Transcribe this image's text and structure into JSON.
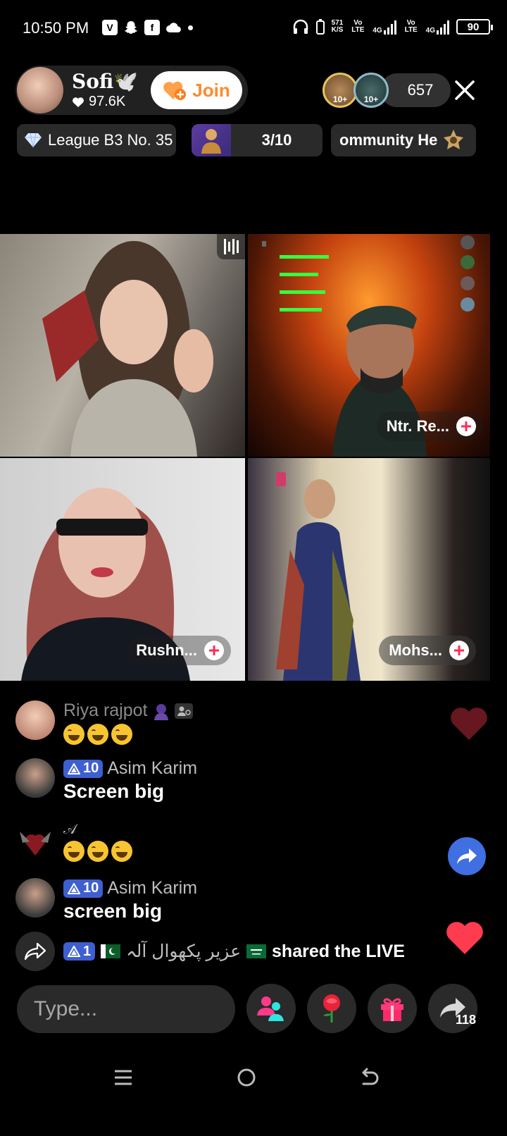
{
  "status_bar": {
    "time": "10:50 PM",
    "net_speed_value": "571",
    "net_speed_unit": "K/S",
    "sim1_type": "4G",
    "sim2_type": "4G",
    "volte1": "Vo LTE",
    "volte2": "Vo LTE",
    "battery": "90"
  },
  "host": {
    "name": "Sofi🕊️",
    "likes": "97.6K",
    "join_label": "Join"
  },
  "viewers": {
    "badge1": "10+",
    "badge2": "10+",
    "count": "657"
  },
  "badges": {
    "league": "League B3 No. 35",
    "rank_progress": "3/10",
    "community": "ommunity He"
  },
  "guests": [
    {
      "name": ""
    },
    {
      "name": "Ntr. Re..."
    },
    {
      "name": "Rushn..."
    },
    {
      "name": "Mohs..."
    }
  ],
  "chat": [
    {
      "user": "Riya rajpot",
      "level": "",
      "message": ""
    },
    {
      "user": "Asim Karim",
      "level": "10",
      "message": "Screen big"
    },
    {
      "user": "𝒜",
      "level": "",
      "message": ""
    },
    {
      "user": "Asim Karim",
      "level": "10",
      "message": "screen big"
    }
  ],
  "share_notice": {
    "level": "1",
    "user": "عزیر پکھوال آلہ",
    "action": "shared the LIVE"
  },
  "bottom_bar": {
    "input_placeholder": "Type...",
    "share_count": "118"
  },
  "icons": {
    "status": [
      "headphones-icon",
      "battery-icon",
      "signal-icon"
    ],
    "bottom": [
      "multi-guest-icon",
      "rose-gift-icon",
      "gift-box-icon",
      "share-icon"
    ],
    "nav": [
      "menu-icon",
      "home-icon",
      "back-icon"
    ]
  },
  "colors": {
    "join_text": "#ff8a2d",
    "level_badge": "#3e5fcf",
    "like_heart": "#ff3b4f",
    "plus_accent": "#fe2c55"
  }
}
